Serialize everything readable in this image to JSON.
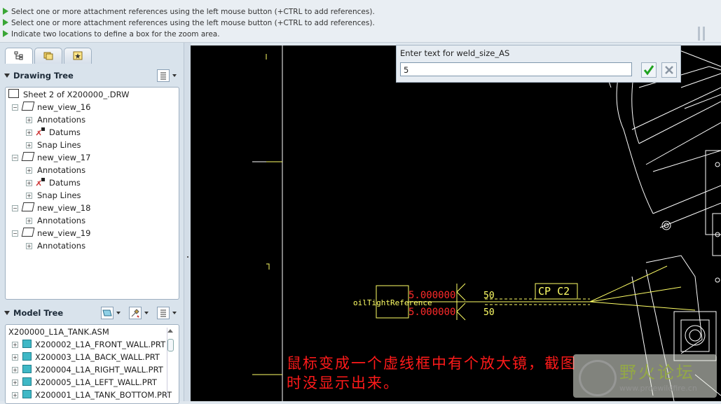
{
  "messages": [
    "Select one or more attachment references using the left mouse button (+CTRL to add references).",
    "Select one or more attachment references using the left mouse button (+CTRL to add references).",
    "Indicate two locations to define a box for the zoom area."
  ],
  "drawing_tree": {
    "title": "Drawing Tree",
    "root": "Sheet 2 of X200000_.DRW",
    "views": [
      {
        "name": "new_view_16",
        "children": [
          "Annotations",
          "Datums",
          "Snap Lines"
        ]
      },
      {
        "name": "new_view_17",
        "children": [
          "Annotations",
          "Datums",
          "Snap Lines"
        ]
      },
      {
        "name": "new_view_18",
        "children": [
          "Annotations"
        ]
      },
      {
        "name": "new_view_19",
        "children": [
          "Annotations"
        ]
      }
    ]
  },
  "model_tree": {
    "title": "Model Tree",
    "root": "X200000_L1A_TANK.ASM",
    "items": [
      "X200002_L1A_FRONT_WALL.PRT",
      "X200003_L1A_BACK_WALL.PRT",
      "X200004_L1A_RIGHT_WALL.PRT",
      "X200005_L1A_LEFT_WALL.PRT",
      "X200001_L1A_TANK_BOTTOM.PRT"
    ]
  },
  "dialog": {
    "prompt": "Enter text for weld_size_AS",
    "value": "5"
  },
  "drawing": {
    "symbol_text": "oilTightReference",
    "value_top": "5.000000",
    "value_bottom": "5.000000",
    "dim_top": "50",
    "dim_bottom": "50",
    "tag": "CP C2"
  },
  "annotation": {
    "line1": "鼠标变成一个虚线框中有个放大镜，截图",
    "line2": "时没显示出来。"
  },
  "watermark": {
    "title": "野火论坛",
    "url": "www.proewildfire.cn"
  },
  "colors": {
    "arrow_green": "#3aa636",
    "accept_green": "#1fa21f",
    "annotation_red": "#ff1a1a",
    "drawing_yellow": "#ffff66",
    "canvas_bg": "#000000"
  }
}
